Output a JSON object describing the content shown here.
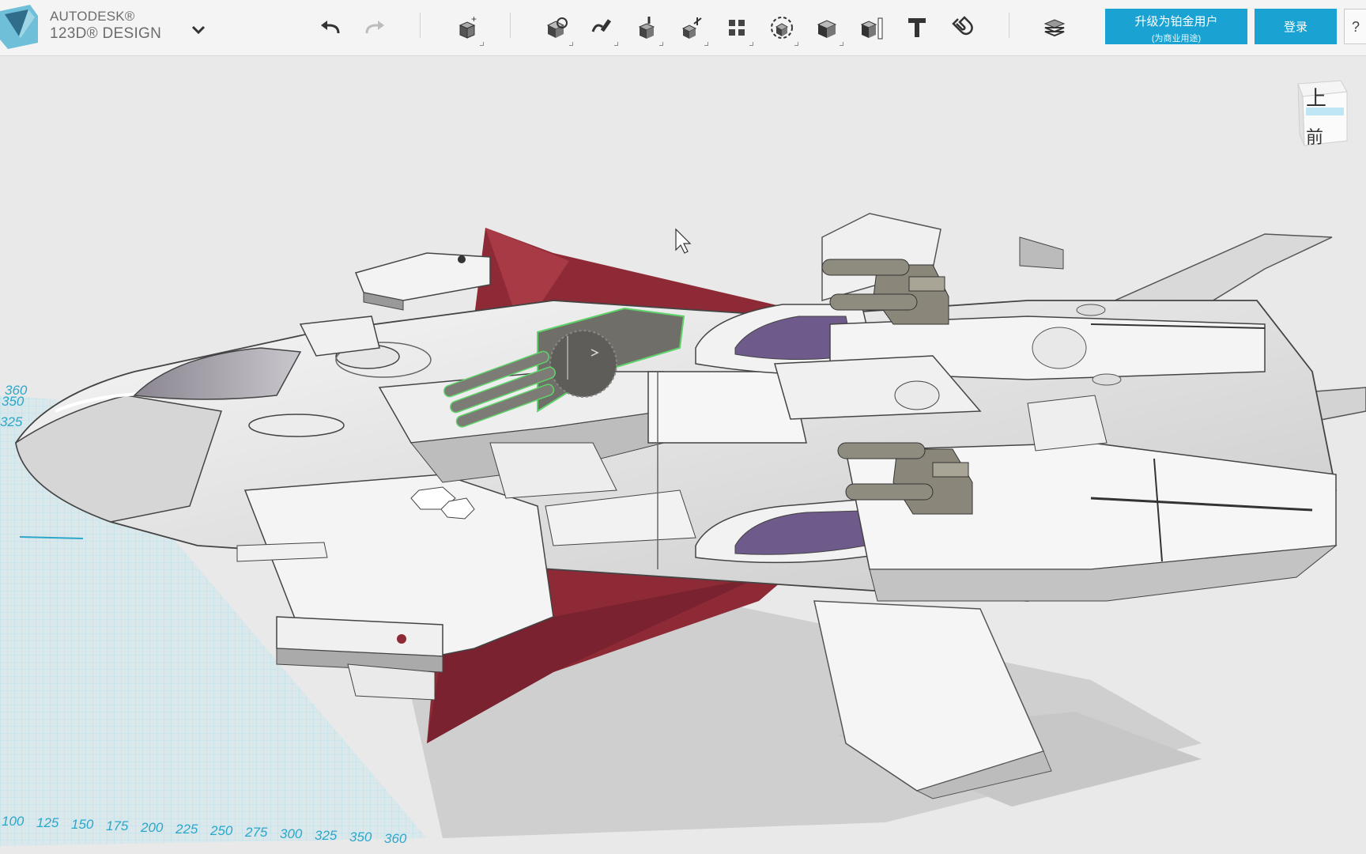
{
  "brand": {
    "line1": "AUTODESK®",
    "line2": "123D® DESIGN"
  },
  "toolbar": {
    "undo": "undo-icon",
    "redo": "redo-icon",
    "tools": [
      "primitives-icon",
      "sketch-icon",
      "construct-icon",
      "modify-icon",
      "transform-icon",
      "pattern-icon",
      "group-icon",
      "combine-icon",
      "measure-icon",
      "text-icon",
      "snap-icon",
      "materials-icon"
    ]
  },
  "account": {
    "upgrade_line1": "升级为铂金用户",
    "upgrade_line2": "(为商业用途)",
    "login": "登录",
    "help": "?"
  },
  "viewcube": {
    "top": "上",
    "front": "前"
  },
  "grid": {
    "x_ticks": [
      "100",
      "125",
      "150",
      "175",
      "200",
      "225",
      "250",
      "275",
      "300",
      "325",
      "350",
      "360"
    ],
    "y_ticks": [
      "360",
      "350",
      "325"
    ]
  },
  "colors": {
    "accent": "#1aa3d2",
    "grid": "#7fd0e6",
    "wing_red": "#8e2a35",
    "panel_white": "#f2f2f2"
  }
}
